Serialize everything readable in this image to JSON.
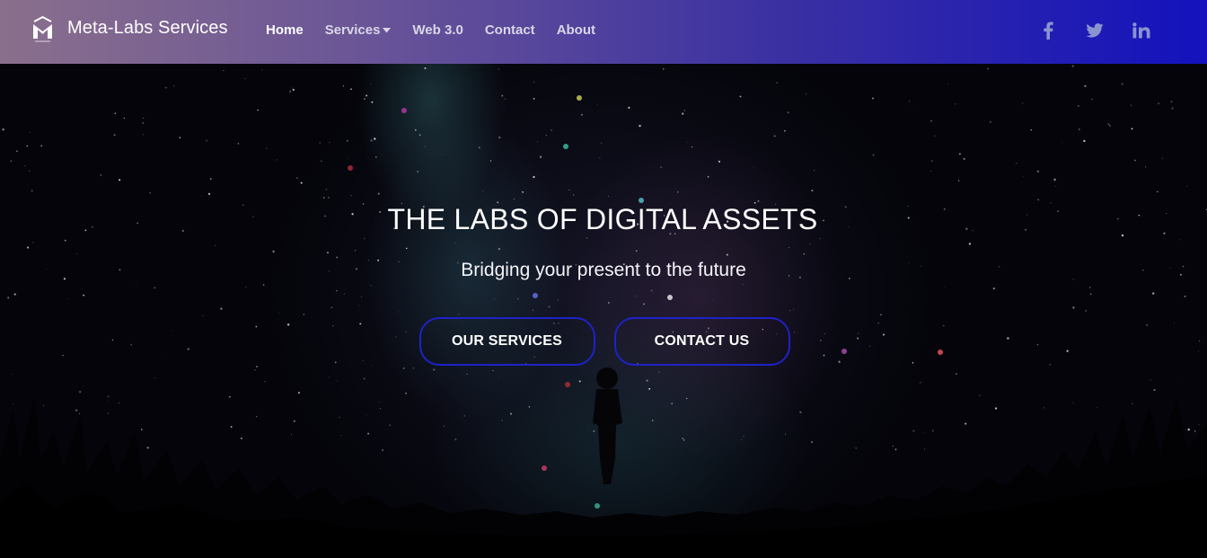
{
  "brand": {
    "name": "Meta-Labs Services",
    "logo_icon": "mlabs-logo-icon"
  },
  "nav": {
    "items": [
      {
        "label": "Home",
        "active": true
      },
      {
        "label": "Services",
        "has_dropdown": true,
        "icon": "caret-down-icon"
      },
      {
        "label": "Web 3.0"
      },
      {
        "label": "Contact"
      },
      {
        "label": "About"
      }
    ]
  },
  "socials": [
    {
      "icon": "facebook-icon"
    },
    {
      "icon": "twitter-icon"
    },
    {
      "icon": "linkedin-icon"
    }
  ],
  "hero": {
    "title": "THE LABS OF DIGITAL ASSETS",
    "subtitle": "Bridging your present to the future",
    "buttons": [
      {
        "label": "OUR SERVICES"
      },
      {
        "label": "CONTACT US"
      }
    ],
    "background": "starry-night-sky-with-silhouette"
  },
  "colors": {
    "nav_gradient_start": "#8a6f8c",
    "nav_gradient_end": "#1312bd",
    "button_border": "#1e22c8",
    "hero_background": "#04040a",
    "text": "#ffffff"
  }
}
